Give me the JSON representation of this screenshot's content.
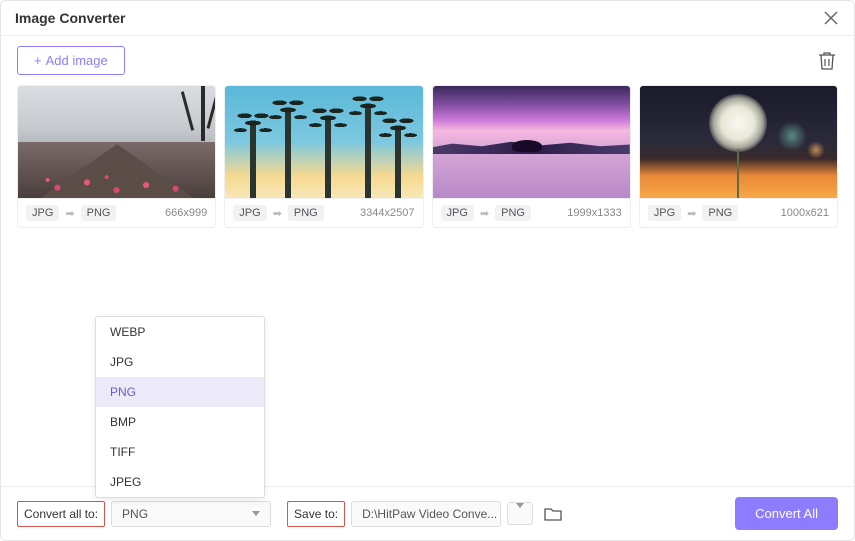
{
  "window": {
    "title": "Image Converter"
  },
  "toolbar": {
    "add_image_label": "Add image"
  },
  "images": [
    {
      "from": "JPG",
      "to": "PNG",
      "dims": "666x999"
    },
    {
      "from": "JPG",
      "to": "PNG",
      "dims": "3344x2507"
    },
    {
      "from": "JPG",
      "to": "PNG",
      "dims": "1999x1333"
    },
    {
      "from": "JPG",
      "to": "PNG",
      "dims": "1000x621"
    }
  ],
  "format_dropdown": {
    "options": [
      "WEBP",
      "JPG",
      "PNG",
      "BMP",
      "TIFF",
      "JPEG"
    ],
    "selected": "PNG"
  },
  "bottom": {
    "convert_all_to_label": "Convert all to:",
    "convert_format_selected": "PNG",
    "save_to_label": "Save to:",
    "save_to_path": "D:\\HitPaw Video Conve...",
    "convert_all_button": "Convert All"
  }
}
